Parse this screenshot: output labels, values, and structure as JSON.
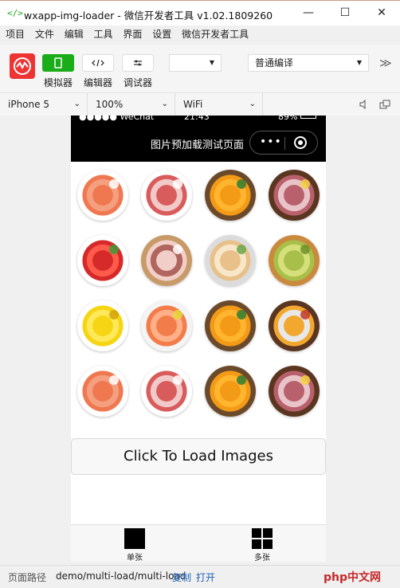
{
  "window": {
    "title": "wxapp-img-loader - 微信开发者工具 v1.02.1809260",
    "icon": "code-brackets-icon",
    "controls": [
      "—",
      "☐",
      "✕"
    ]
  },
  "menu": [
    "项目",
    "文件",
    "编辑",
    "工具",
    "界面",
    "设置",
    "微信开发者工具"
  ],
  "toolbar": {
    "simulator_label": "模拟器",
    "editor_label": "编辑器",
    "debugger_label": "调试器",
    "mode_select_value": "",
    "compile_select_value": "普通编译",
    "more_label": "≫",
    "accent": "#1aad19"
  },
  "device_bar": {
    "device": "iPhone 5",
    "zoom": "100%",
    "network": "WiFi"
  },
  "phone": {
    "status": {
      "carrier": "●●●●● WeChat",
      "time": "21:43",
      "battery": "89%"
    },
    "nav_title": "图片预加载测试页面",
    "capsule_dots": "•••",
    "images": [
      {
        "kind": "salmon"
      },
      {
        "kind": "bacon"
      },
      {
        "kind": "oranges"
      },
      {
        "kind": "ham"
      },
      {
        "kind": "apples"
      },
      {
        "kind": "pork"
      },
      {
        "kind": "fish"
      },
      {
        "kind": "pears"
      },
      {
        "kind": "lemons"
      },
      {
        "kind": "shrimp"
      },
      {
        "kind": "oranges"
      },
      {
        "kind": "drinks"
      },
      {
        "kind": "salmon"
      },
      {
        "kind": "bacon"
      },
      {
        "kind": "oranges"
      },
      {
        "kind": "ham"
      }
    ],
    "load_button": "Click To Load Images",
    "tabs": [
      {
        "label": "单张",
        "icon": "single-square-icon"
      },
      {
        "label": "多张",
        "icon": "grid-squares-icon"
      }
    ]
  },
  "footer": {
    "path_label": "页面路径",
    "path_value": "demo/multi-load/multi-load",
    "copy_label": "复制",
    "open_label": "打开",
    "watermark": "php中文网"
  }
}
